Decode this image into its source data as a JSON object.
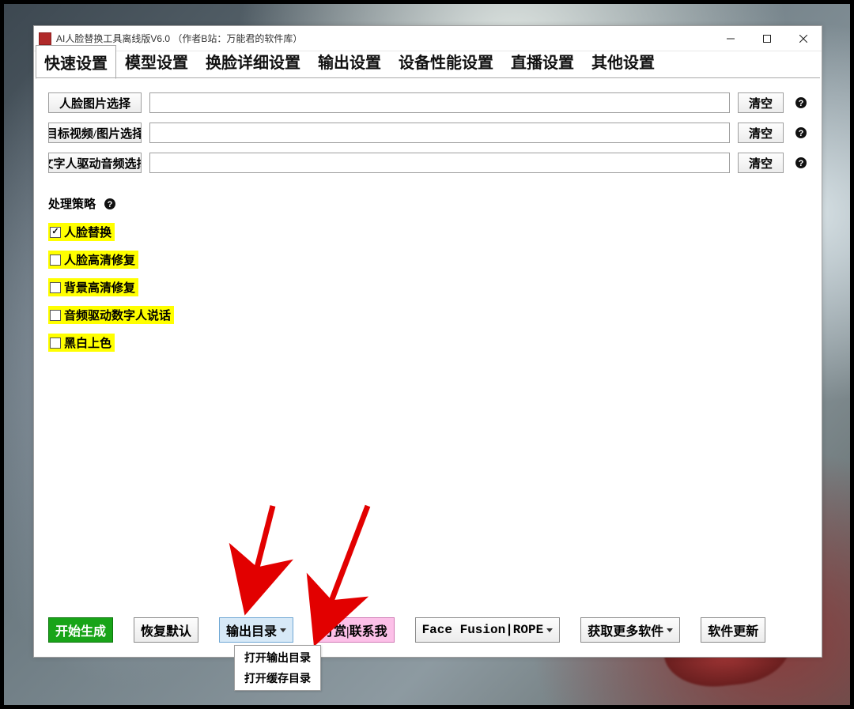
{
  "window": {
    "title": "AI人脸替换工具离线版V6.0 （作者B站：万能君的软件库）"
  },
  "tabs": [
    "快速设置",
    "模型设置",
    "换脸详细设置",
    "输出设置",
    "设备性能设置",
    "直播设置",
    "其他设置"
  ],
  "active_tab": 0,
  "file_rows": [
    {
      "button": "人脸图片选择",
      "value": "",
      "clear": "清空"
    },
    {
      "button": "目标视频/图片选择",
      "value": "",
      "clear": "清空"
    },
    {
      "button": "文字人驱动音频选择",
      "value": "",
      "clear": "清空"
    }
  ],
  "strategy_label": "处理策略",
  "strategies": [
    {
      "label": "人脸替换",
      "checked": true
    },
    {
      "label": "人脸高清修复",
      "checked": false
    },
    {
      "label": "背景高清修复",
      "checked": false
    },
    {
      "label": "音频驱动数字人说话",
      "checked": false
    },
    {
      "label": "黑白上色",
      "checked": false
    }
  ],
  "bottom_buttons": {
    "start": "开始生成",
    "reset": "恢复默认",
    "output_dir": "输出目录",
    "donate": "打赏|联系我",
    "fusion": "Face Fusion|ROPE",
    "more": "获取更多软件",
    "update": "软件更新"
  },
  "dropdown_items": [
    "打开输出目录",
    "打开缓存目录"
  ]
}
